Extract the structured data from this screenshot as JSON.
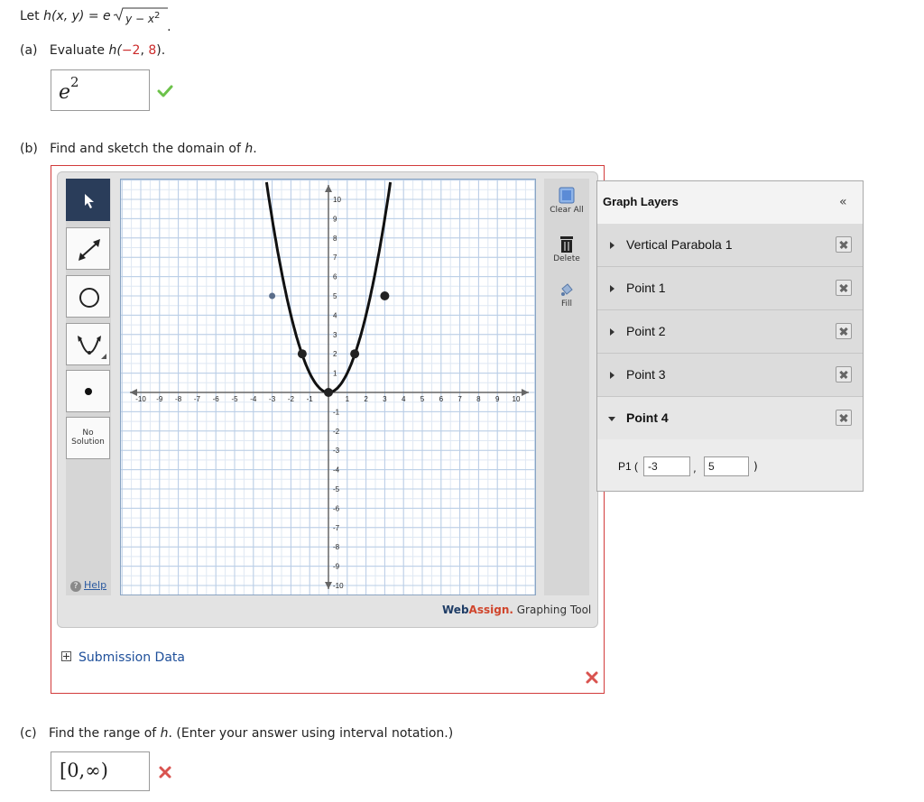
{
  "problem": {
    "lead": "Let",
    "func": "h(x, y) = e",
    "exponent": "y − x",
    "exp_power": "2",
    "period": "."
  },
  "part_a": {
    "label": "(a)",
    "text": "Evaluate",
    "func": "h(",
    "arg1": "−2",
    "comma": ", ",
    "arg2": "8",
    "close": ").",
    "answer_base": "e",
    "answer_power": "2",
    "status": "correct"
  },
  "part_b": {
    "label": "(b)",
    "text": "Find and sketch the domain of",
    "var": "h",
    "period": "."
  },
  "toolbar": {
    "tools": [
      "pointer",
      "line",
      "circle",
      "parabola",
      "point",
      "no-solution"
    ],
    "no_solution_line1": "No",
    "no_solution_line2": "Solution",
    "help": "Help",
    "clear_all": "Clear All",
    "delete": "Delete",
    "fill": "Fill"
  },
  "graph": {
    "x_ticks": [
      "-10",
      "-9",
      "-8",
      "-7",
      "-6",
      "-5",
      "-4",
      "-3",
      "-2",
      "-1",
      "1",
      "2",
      "3",
      "4",
      "5",
      "6",
      "7",
      "8",
      "9",
      "10"
    ],
    "y_ticks": [
      "10",
      "9",
      "8",
      "7",
      "6",
      "5",
      "4",
      "3",
      "2",
      "1",
      "-1",
      "-2",
      "-3",
      "-4",
      "-5",
      "-6",
      "-7",
      "-8",
      "-9",
      "-10"
    ],
    "parabola": "y = x^2",
    "points": [
      {
        "x": 0,
        "y": 0
      },
      {
        "x": -1.4,
        "y": 2
      },
      {
        "x": 1.4,
        "y": 2
      },
      {
        "x": -3,
        "y": 5
      },
      {
        "x": 3,
        "y": 5
      }
    ],
    "curve_color": "#111111",
    "grid_color": "#b9cde6"
  },
  "branding": {
    "web": "Web",
    "assign": "Assign.",
    "tool": " Graphing Tool"
  },
  "layers": {
    "title": "Graph Layers",
    "collapse": "«",
    "items": [
      {
        "label": "Vertical Parabola 1",
        "expanded": false
      },
      {
        "label": "Point 1",
        "expanded": false
      },
      {
        "label": "Point 2",
        "expanded": false
      },
      {
        "label": "Point 3",
        "expanded": false
      },
      {
        "label": "Point 4",
        "expanded": true
      }
    ],
    "point_editor": {
      "label": "P1 (",
      "x": "-3",
      "sep": ",",
      "y": "5",
      "close": ")"
    }
  },
  "submission": {
    "label": "Submission Data"
  },
  "part_c": {
    "label": "(c)",
    "text1": "Find the range of",
    "var": "h",
    "text2": ". (Enter your answer using interval notation.)",
    "answer": "[0,∞)",
    "status": "incorrect"
  },
  "colors": {
    "correct": "#6cc24a",
    "incorrect": "#d9534f",
    "frame": "#d23b3b",
    "link": "#1e4f9a"
  }
}
